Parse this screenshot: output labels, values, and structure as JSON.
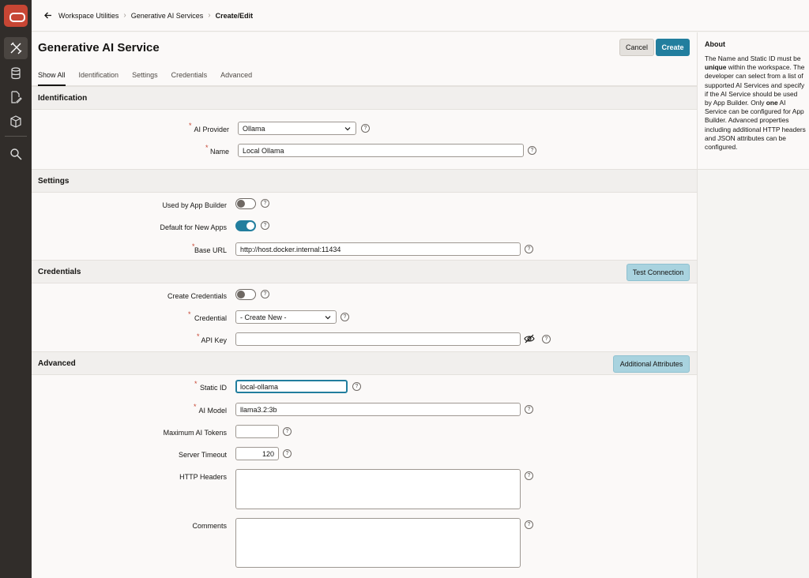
{
  "nav_rail": {
    "items": [
      {
        "name": "logo-icon"
      },
      {
        "name": "tools-icon"
      },
      {
        "name": "database-icon"
      },
      {
        "name": "document-edit-icon"
      },
      {
        "name": "package-icon"
      },
      {
        "name": "search-icon"
      }
    ]
  },
  "breadcrumb": {
    "items": [
      "Workspace Utilities",
      "Generative AI Services",
      "Create/Edit"
    ]
  },
  "page": {
    "title": "Generative AI Service",
    "cancel_label": "Cancel",
    "create_label": "Create"
  },
  "tabs": [
    "Show All",
    "Identification",
    "Settings",
    "Credentials",
    "Advanced"
  ],
  "identification": {
    "title": "Identification",
    "ai_provider_label": "AI Provider",
    "ai_provider_value": "Ollama",
    "name_label": "Name",
    "name_value": "Local Ollama"
  },
  "settings": {
    "title": "Settings",
    "used_by_app_builder_label": "Used by App Builder",
    "used_by_app_builder_on": false,
    "default_for_new_apps_label": "Default for New Apps",
    "default_for_new_apps_on": true,
    "base_url_label": "Base URL",
    "base_url_value": "http://host.docker.internal:11434"
  },
  "credentials": {
    "title": "Credentials",
    "test_connection_label": "Test Connection",
    "create_credentials_label": "Create Credentials",
    "create_credentials_on": false,
    "credential_label": "Credential",
    "credential_value": "- Create New -",
    "api_key_label": "API Key",
    "api_key_value": ""
  },
  "advanced": {
    "title": "Advanced",
    "additional_attributes_label": "Additional Attributes",
    "static_id_label": "Static ID",
    "static_id_value": "local-ollama",
    "ai_model_label": "AI Model",
    "ai_model_value": "llama3.2:3b",
    "max_tokens_label": "Maximum AI Tokens",
    "max_tokens_value": "",
    "server_timeout_label": "Server Timeout",
    "server_timeout_value": "120",
    "http_headers_label": "HTTP Headers",
    "comments_label": "Comments"
  },
  "help_glyph": "?",
  "about": {
    "title": "About",
    "text_1": "The Name and Static ID must be ",
    "text_bold_1": "unique",
    "text_2": " within the workspace. The developer can select from a list of supported AI Services and specify if the AI Service should be used by App Builder. Only ",
    "text_bold_2": "one",
    "text_3": " AI Service can be configured for App Builder. Advanced properties including additional HTTP headers and JSON attributes can be configured."
  },
  "colors": {
    "brand_red": "#c74634",
    "primary_button": "#227e9e",
    "secondary_button": "#a9d3df",
    "rail_background": "#312d2a"
  }
}
